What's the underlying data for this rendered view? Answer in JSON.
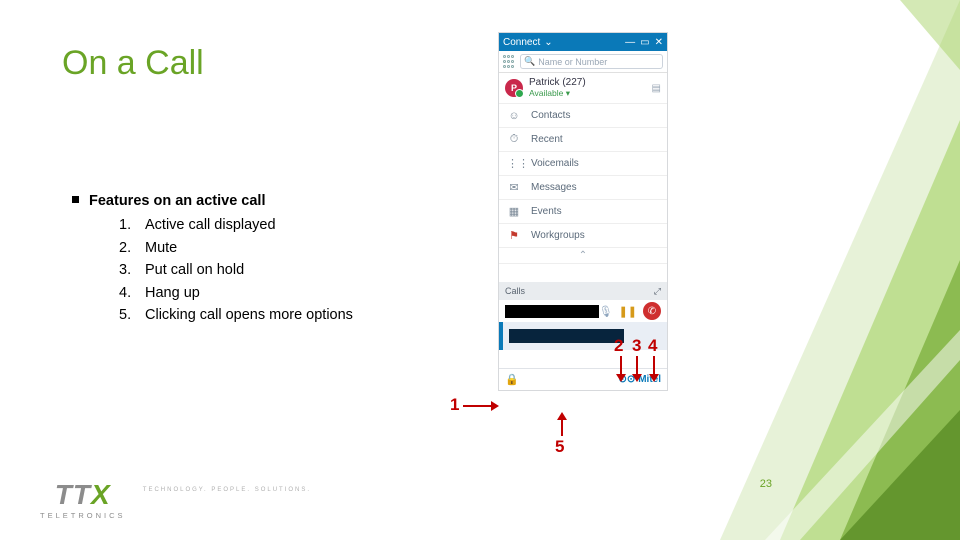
{
  "title": "On a Call",
  "bullet_heading": "Features on an active call",
  "features": [
    "Active call displayed",
    "Mute",
    "Put call on hold",
    "Hang up",
    "Clicking call opens more options"
  ],
  "screenshot": {
    "titlebar": "Connect",
    "search_placeholder": "Name or Number",
    "user_name": "Patrick (227)",
    "user_status": "Available ▾",
    "nav_items": [
      {
        "label": "Contacts",
        "icon": "☺"
      },
      {
        "label": "Recent",
        "icon": "⏱"
      },
      {
        "label": "Voicemails",
        "icon": "⋮⋮"
      },
      {
        "label": "Messages",
        "icon": "✉"
      },
      {
        "label": "Events",
        "icon": "▦"
      },
      {
        "label": "Workgroups",
        "icon": "⚑"
      }
    ],
    "calls_header": "Calls",
    "footer_brand": "Mitel"
  },
  "annotations": {
    "n1": "1",
    "n2": "2",
    "n3": "3",
    "n4": "4",
    "n5": "5"
  },
  "logo": {
    "mark": "TTX",
    "sub": "TELETRONICS",
    "tag": "TECHNOLOGY. PEOPLE. SOLUTIONS."
  },
  "page_number": "23"
}
